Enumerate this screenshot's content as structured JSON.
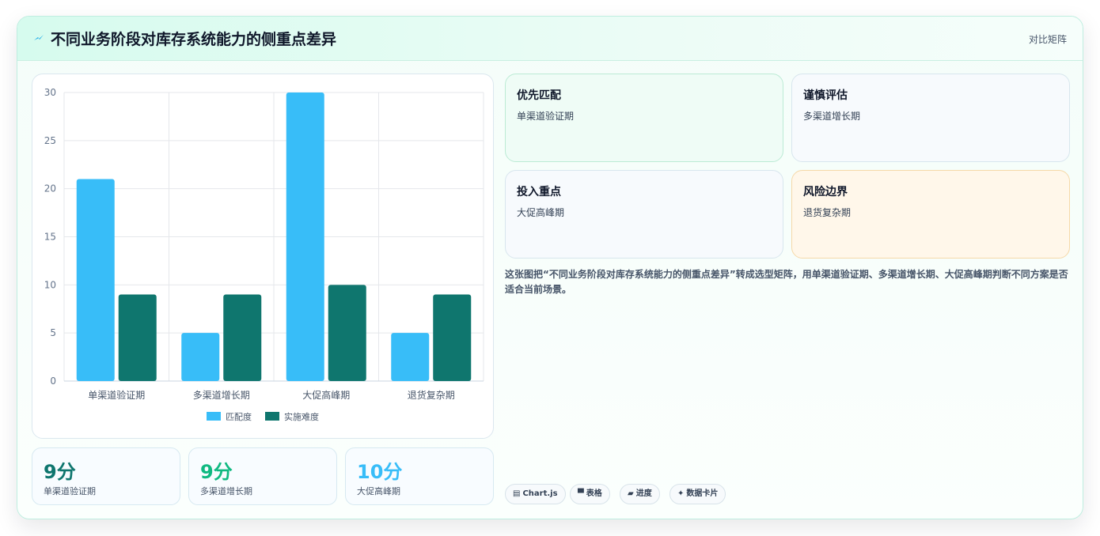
{
  "header": {
    "title": "不同业务阶段对库存系统能力的侧重点差异",
    "tag": "对比矩阵",
    "icon": "lightning-icon"
  },
  "chart_data": {
    "type": "bar",
    "categories": [
      "单渠道验证期",
      "多渠道增长期",
      "大促高峰期",
      "退货复杂期"
    ],
    "series": [
      {
        "name": "匹配度",
        "values": [
          21,
          5,
          30,
          5
        ],
        "color": "#38bdf8"
      },
      {
        "name": "实施难度",
        "values": [
          9,
          9,
          10,
          9
        ],
        "color": "#0f766e"
      }
    ],
    "ylim": [
      0,
      30
    ],
    "yticks": [
      0,
      5,
      10,
      15,
      20,
      25,
      30
    ],
    "grid": true,
    "legend": "bottom"
  },
  "stats": [
    {
      "value": "9分",
      "label": "单渠道验证期",
      "color": "#0f766e"
    },
    {
      "value": "9分",
      "label": "多渠道增长期",
      "color": "#10b981"
    },
    {
      "value": "10分",
      "label": "大促高峰期",
      "color": "#38bdf8"
    }
  ],
  "matrix": [
    {
      "title": "优先匹配",
      "text": "单渠道验证期",
      "bg": "#effcf6",
      "border": "#bcebd5"
    },
    {
      "title": "谨慎评估",
      "text": "多渠道增长期",
      "bg": "#f7fafd",
      "border": "#d8e6ee"
    },
    {
      "title": "投入重点",
      "text": "大促高峰期",
      "bg": "#f7fafd",
      "border": "#d8e6ee"
    },
    {
      "title": "风险边界",
      "text": "退货复杂期",
      "bg": "#fff7ea",
      "border": "#f6d9a8"
    }
  ],
  "description": "这张图把“不同业务阶段对库存系统能力的侧重点差异”转成选型矩阵，用单渠道验证期、多渠道增长期、大促高峰期判断不同方案是否适合当前场景。",
  "chips": [
    {
      "icon": "chart-icon",
      "glyph": "▤",
      "label": "Chart.js"
    },
    {
      "icon": "table-icon",
      "glyph": "▀",
      "label": "表格"
    },
    {
      "icon": "progress-icon",
      "glyph": "▰",
      "label": "进度"
    },
    {
      "icon": "sparkle-icon",
      "glyph": "✦",
      "label": "数据卡片"
    }
  ]
}
